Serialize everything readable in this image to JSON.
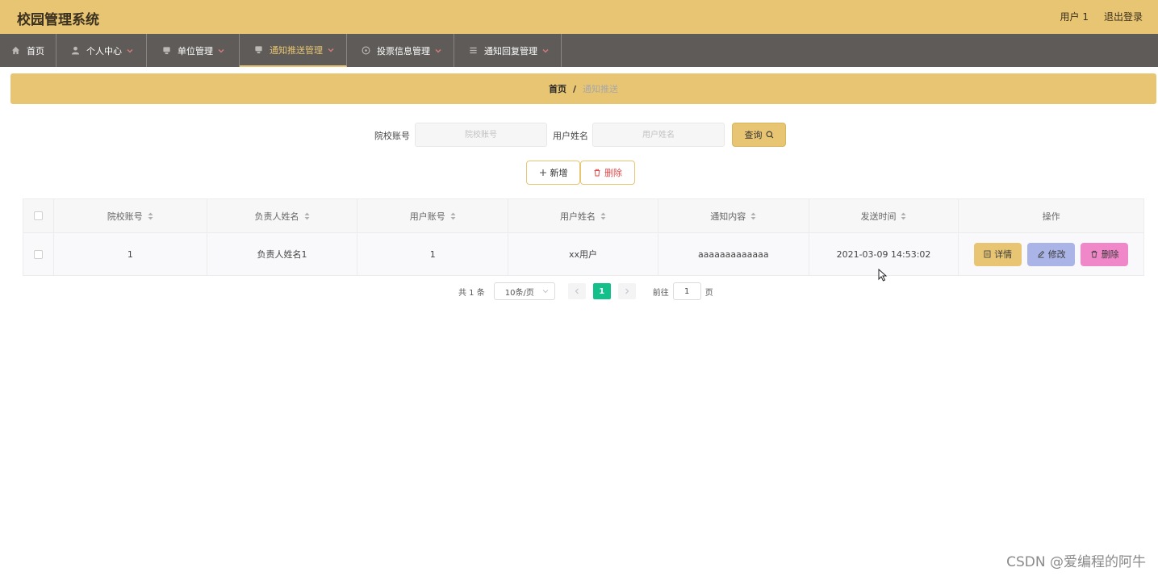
{
  "header": {
    "title": "校园管理系统",
    "user_label": "用户 1",
    "logout_label": "退出登录"
  },
  "nav": {
    "items": [
      {
        "label": "首页",
        "icon": "home-icon"
      },
      {
        "label": "个人中心",
        "icon": "user-icon"
      },
      {
        "label": "单位管理",
        "icon": "monitor-icon"
      },
      {
        "label": "通知推送管理",
        "icon": "monitor-icon"
      },
      {
        "label": "投票信息管理",
        "icon": "dashboard-icon"
      },
      {
        "label": "通知回复管理",
        "icon": "list-icon"
      }
    ],
    "active_index": 3,
    "accent_color": "#e8c572"
  },
  "breadcrumb": {
    "home": "首页",
    "separator": "/",
    "current": "通知推送"
  },
  "search": {
    "field1_label": "院校账号",
    "field1_placeholder": "院校账号",
    "field2_label": "用户姓名",
    "field2_placeholder": "用户姓名",
    "query_label": "查询"
  },
  "actions": {
    "add_label": "新增",
    "delete_label": "删除"
  },
  "table": {
    "columns": [
      "院校账号",
      "负责人姓名",
      "用户账号",
      "用户姓名",
      "通知内容",
      "发送时间",
      "操作"
    ],
    "rows": [
      {
        "school_account": "1",
        "manager_name": "负责人姓名1",
        "user_account": "1",
        "user_name": "xx用户",
        "content": "aaaaaaaaaaaaa",
        "send_time": "2021-03-09 14:53:02"
      }
    ],
    "row_actions": {
      "detail": "详情",
      "edit": "修改",
      "delete": "删除"
    }
  },
  "pagination": {
    "total": "共 1 条",
    "page_size": "10条/页",
    "current_page": "1",
    "goto_label": "前往",
    "goto_value": "1",
    "page_suffix": "页"
  },
  "watermark": "CSDN @爱编程的阿牛",
  "colors": {
    "header_bg": "#e8c572",
    "nav_bg": "#5e5b58",
    "page_active": "#13c08a",
    "edit_btn": "#aab4e6",
    "delete_btn": "#f087c8"
  }
}
